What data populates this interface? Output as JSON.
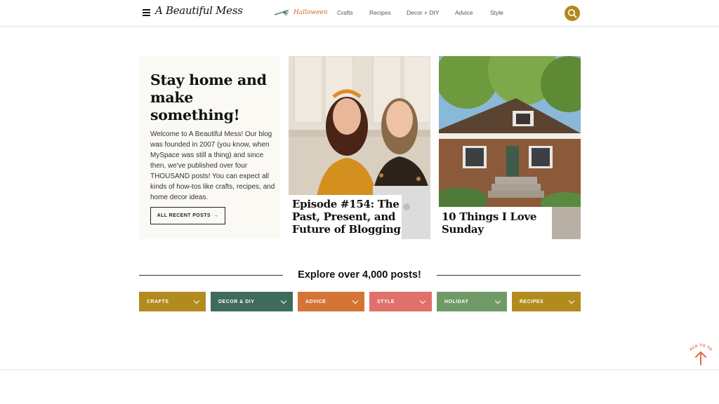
{
  "header": {
    "logo": "A Beautiful Mess",
    "nav": [
      {
        "label": "Halloween"
      },
      {
        "label": "Crafts"
      },
      {
        "label": "Recipes"
      },
      {
        "label": "Decor + DIY"
      },
      {
        "label": "Advice"
      },
      {
        "label": "Style"
      }
    ]
  },
  "intro": {
    "title": "Stay home and make something!",
    "text": "Welcome to A Beautiful Mess! Our blog was founded in 2007 (you know, when MySpace was still a thing) and since then, we've published over four THOUSAND posts! You can expect all kinds of how-tos like crafts, recipes, and home decor ideas.",
    "button": "ALL RECENT POSTS"
  },
  "posts": [
    {
      "title": "Episode #154: The Past, Present, and Future of Blogging"
    },
    {
      "title": "10 Things I Love Sunday"
    }
  ],
  "explore": {
    "title": "Explore over 4,000 posts!",
    "categories": [
      {
        "label": "CRAFTS",
        "color": "#b28b1f"
      },
      {
        "label": "DECOR & DIY",
        "color": "#3f6b5a"
      },
      {
        "label": "ADVICE",
        "color": "#d47436"
      },
      {
        "label": "STYLE",
        "color": "#e0706a"
      },
      {
        "label": "HOLIDAY",
        "color": "#6f9a67"
      },
      {
        "label": "RECIPES",
        "color": "#b28b1f"
      }
    ]
  },
  "back_to_top": "BACK TO TOP",
  "colors": {
    "accent": "#b0891a",
    "halloween": "#d36a2b",
    "back_to_top": "#e06a45"
  }
}
